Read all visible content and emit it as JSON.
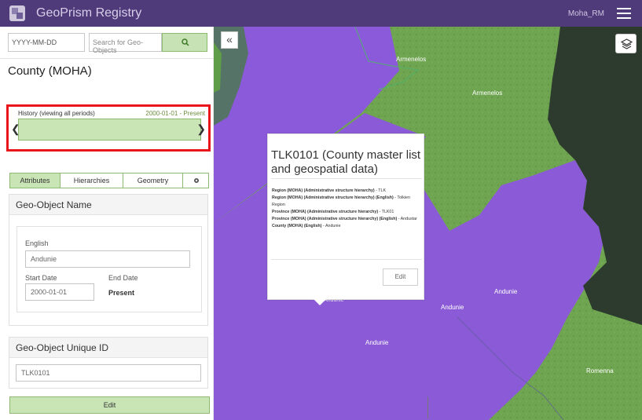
{
  "header": {
    "title": "GeoPrism Registry",
    "user": "Moha_RM"
  },
  "sidebar": {
    "date_placeholder": "YYYY-MM-DD",
    "search_placeholder": "Search for Geo-Objects",
    "county_title": "County (MOHA)",
    "history": {
      "label": "History  (viewing all periods)",
      "range": "2000-01-01 - Present"
    },
    "tabs": [
      "Attributes",
      "Hierarchies",
      "Geometry"
    ],
    "geo_object_name": {
      "header": "Geo-Object Name",
      "language": "English",
      "name_value": "Andunie",
      "start_label": "Start Date",
      "end_label": "End Date",
      "start_value": "2000-01-01",
      "end_value": "Present"
    },
    "geo_object_id": {
      "header": "Geo-Object Unique ID",
      "value": "TLK0101"
    },
    "edit_label": "Edit"
  },
  "map": {
    "labels": {
      "armenelos_top": "Armenelos",
      "armenelos_right": "Armenelos",
      "andunie_popup": "Andunie",
      "andunie_bottom": "Andunie",
      "andunie_mid": "Andunie",
      "andunie_right": "Andunie",
      "romenna": "Romenna"
    },
    "popup": {
      "title": "TLK0101 (County master list and geospatial data)",
      "lines": [
        {
          "label": "Region (MOHA) (Administrative structure hierarchy)",
          "value": " - TLK"
        },
        {
          "label": "Region (MOHA) (Administrative structure hierarchy) (English)",
          "value": " - Tolkien Region"
        },
        {
          "label": "Province (MOHA) (Administrative structure hierarchy)",
          "value": " - TLK01"
        },
        {
          "label": "Province (MOHA) (Administrative structure hierarchy) (English)",
          "value": " - Andustar"
        },
        {
          "label": "County (MOHA) (English)",
          "value": " - Andunie"
        }
      ],
      "edit": "Edit"
    }
  }
}
